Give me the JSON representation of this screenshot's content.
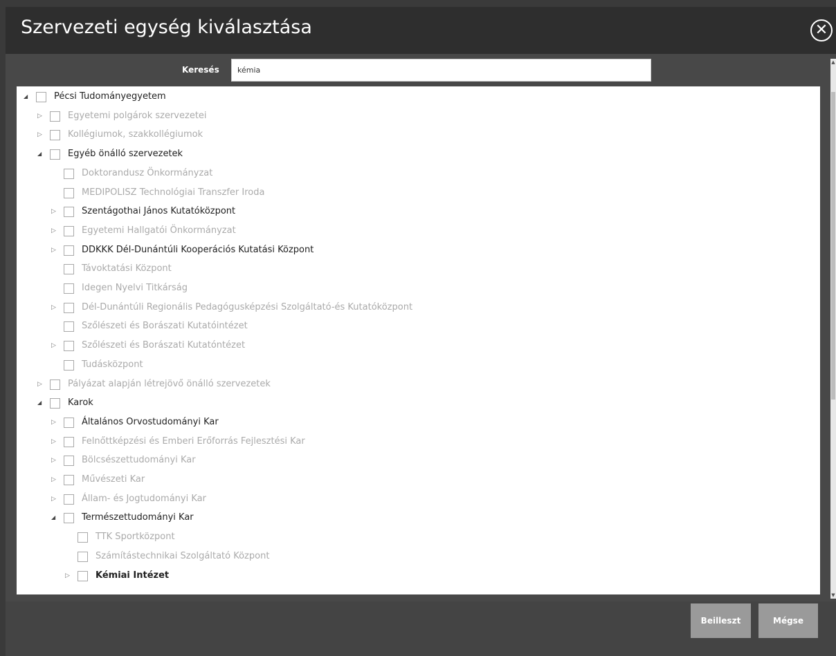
{
  "dialog": {
    "title": "Szervezeti egység kiválasztása",
    "close_label": "✕"
  },
  "search": {
    "label": "Keresés",
    "value": "kémia"
  },
  "tree": [
    {
      "label": "Pécsi Tudományegyetem",
      "level": 0,
      "arrow": "open",
      "style": "dark"
    },
    {
      "label": "Egyetemi polgárok szervezetei",
      "level": 1,
      "arrow": "closed",
      "style": "grey"
    },
    {
      "label": "Kollégiumok, szakkollégiumok",
      "level": 1,
      "arrow": "closed",
      "style": "grey"
    },
    {
      "label": "Egyéb önálló szervezetek",
      "level": 1,
      "arrow": "open",
      "style": "dark"
    },
    {
      "label": "Doktorandusz Önkormányzat",
      "level": 2,
      "arrow": "none",
      "style": "grey"
    },
    {
      "label": "MEDIPOLISZ Technológiai Transzfer Iroda",
      "level": 2,
      "arrow": "none",
      "style": "grey"
    },
    {
      "label": "Szentágothai János Kutatóközpont",
      "level": 2,
      "arrow": "closed",
      "style": "dark"
    },
    {
      "label": "Egyetemi Hallgatói Önkormányzat",
      "level": 2,
      "arrow": "closed",
      "style": "grey"
    },
    {
      "label": "DDKKK Dél-Dunántúli Kooperációs Kutatási Központ",
      "level": 2,
      "arrow": "closed",
      "style": "dark"
    },
    {
      "label": "Távoktatási Központ",
      "level": 2,
      "arrow": "none",
      "style": "grey"
    },
    {
      "label": "Idegen Nyelvi Titkárság",
      "level": 2,
      "arrow": "none",
      "style": "grey"
    },
    {
      "label": "Dél-Dunántúli Regionális Pedagógusképzési Szolgáltató-és Kutatóközpont",
      "level": 2,
      "arrow": "closed",
      "style": "grey"
    },
    {
      "label": "Szőlészeti és Borászati Kutatóintézet",
      "level": 2,
      "arrow": "none",
      "style": "grey"
    },
    {
      "label": "Szőlészeti és Borászati Kutatóntézet",
      "level": 2,
      "arrow": "closed",
      "style": "grey"
    },
    {
      "label": "Tudásközpont",
      "level": 2,
      "arrow": "none",
      "style": "grey"
    },
    {
      "label": "Pályázat alapján létrejövő önálló szervezetek",
      "level": 1,
      "arrow": "closed",
      "style": "grey"
    },
    {
      "label": "Karok",
      "level": 1,
      "arrow": "open",
      "style": "dark"
    },
    {
      "label": "Általános Orvostudományi Kar",
      "level": 2,
      "arrow": "closed",
      "style": "dark"
    },
    {
      "label": "Felnőttképzési és Emberi Erőforrás Fejlesztési Kar",
      "level": 2,
      "arrow": "closed",
      "style": "grey"
    },
    {
      "label": "Bölcsészettudományi Kar",
      "level": 2,
      "arrow": "closed",
      "style": "grey"
    },
    {
      "label": "Művészeti Kar",
      "level": 2,
      "arrow": "closed",
      "style": "grey"
    },
    {
      "label": "Állam- és Jogtudományi Kar",
      "level": 2,
      "arrow": "closed",
      "style": "grey"
    },
    {
      "label": "Természettudományi Kar",
      "level": 2,
      "arrow": "open",
      "style": "dark"
    },
    {
      "label": "TTK Sportközpont",
      "level": 3,
      "arrow": "none",
      "style": "grey"
    },
    {
      "label": "Számítástechnikai Szolgáltató Központ",
      "level": 3,
      "arrow": "none",
      "style": "grey"
    },
    {
      "label": "Kémiai Intézet",
      "level": 3,
      "arrow": "closed",
      "style": "bold"
    }
  ],
  "buttons": {
    "insert_label": "Beilleszt",
    "cancel_label": "Mégse"
  },
  "icons": {
    "close": "close-icon",
    "expand": "triangle-right-icon",
    "collapse": "triangle-down-icon"
  }
}
